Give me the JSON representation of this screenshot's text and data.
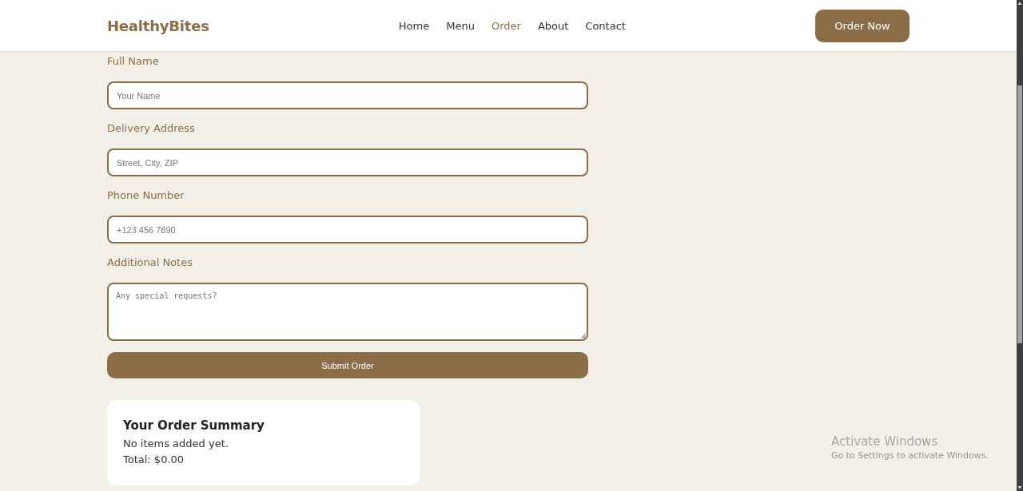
{
  "header": {
    "logo": "HealthyBites",
    "nav": [
      {
        "label": "Home",
        "selected": false
      },
      {
        "label": "Menu",
        "selected": false
      },
      {
        "label": "Order",
        "selected": true
      },
      {
        "label": "About",
        "selected": false
      },
      {
        "label": "Contact",
        "selected": false
      }
    ],
    "cta": "Order Now"
  },
  "form": {
    "fields": [
      {
        "kind": "input",
        "label": "Full Name",
        "placeholder": "Your Name"
      },
      {
        "kind": "input",
        "label": "Delivery Address",
        "placeholder": "Street, City, ZIP"
      },
      {
        "kind": "input",
        "label": "Phone Number",
        "placeholder": "+123 456 7890"
      },
      {
        "kind": "textarea",
        "label": "Additional Notes",
        "placeholder": "Any special requests?"
      }
    ],
    "submit": "Submit Order"
  },
  "summary": {
    "title": "Your Order Summary",
    "lines": [
      "No items added yet.",
      "Total: $0.00"
    ]
  },
  "os_overlay": {
    "title": "Activate Windows",
    "subtitle": "Go to Settings to activate Windows."
  }
}
